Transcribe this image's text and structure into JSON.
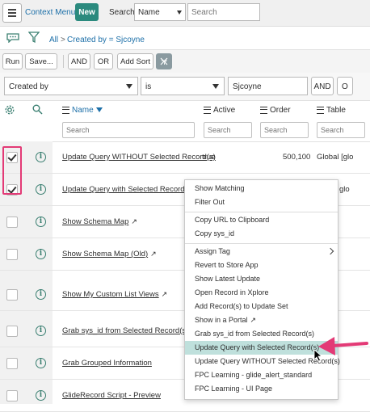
{
  "header": {
    "menu_icon": "hamburger-icon",
    "title": "Context Menus",
    "new_label": "New",
    "search_label": "Search",
    "search_field": "Name",
    "search_placeholder": "Search"
  },
  "breadcrumb": {
    "all": "All",
    "separator": ">",
    "filter": "Created by = Sjcoyne"
  },
  "toolbar": {
    "run": "Run",
    "save": "Save...",
    "and": "AND",
    "or": "OR",
    "add_sort": "Add Sort"
  },
  "condition": {
    "field": "Created by",
    "operator": "is",
    "value": "Sjcoyne",
    "and": "AND",
    "or": "O"
  },
  "columns": {
    "name": "Name",
    "active": "Active",
    "order": "Order",
    "table": "Table",
    "search_placeholder": "Search"
  },
  "rows": [
    {
      "name": "Update Query WITHOUT Selected Record(s)",
      "active": "true",
      "order": "500,100",
      "table": "Global [glo",
      "checked": true
    },
    {
      "name": "Update Query with Selected Record(s)",
      "active": "",
      "order": "",
      "table": "glo",
      "checked": true
    },
    {
      "name": "Show Schema Map",
      "checked": false
    },
    {
      "name": "Show Schema Map (Old)",
      "checked": false
    },
    {
      "name": "Show My Custom List Views",
      "checked": false
    },
    {
      "name": "Grab sys_id from Selected Record(s)",
      "checked": false
    },
    {
      "name": "Grab Grouped Information",
      "checked": false
    },
    {
      "name": "GlideRecord Script - Preview",
      "checked": false
    }
  ],
  "context_menu": [
    "Show Matching",
    "Filter Out",
    "Copy URL to Clipboard",
    "Copy sys_id",
    "Assign Tag",
    "Revert to Store App",
    "Show Latest Update",
    "Open Record in Xplore",
    "Add Record(s) to Update Set",
    "Show in a Portal",
    "Grab sys_id from Selected Record(s)",
    "Update Query with Selected Record(s)",
    "Update Query WITHOUT Selected Record(s)",
    "FPC Learning - glide_alert_standard",
    "FPC Learning - UI Page"
  ],
  "colors": {
    "brand": "#2b8a7e",
    "link": "#1c6fa8",
    "highlight": "#bfe0dc",
    "annotation": "#e33a76"
  }
}
